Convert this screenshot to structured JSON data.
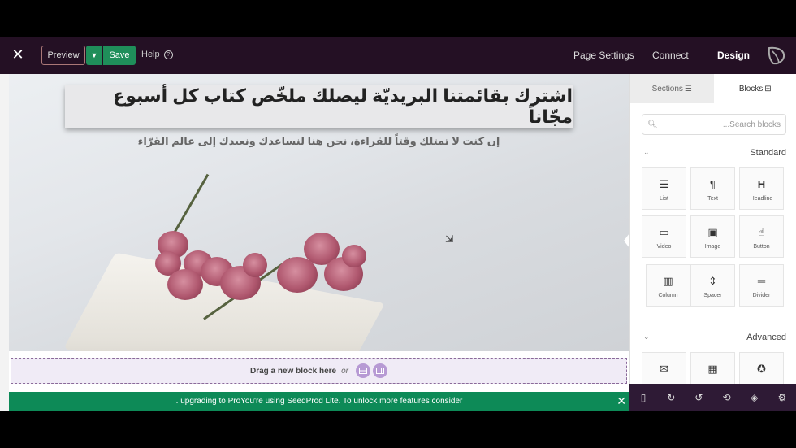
{
  "topbar": {
    "close_icon": "close-icon",
    "preview_label": "Preview",
    "save_label": "Save",
    "help_label": "Help",
    "nav": [
      "Page Settings",
      "Connect",
      "Design"
    ],
    "active_nav": "Design",
    "brand_color": "#241024",
    "save_color": "#1f8e5a"
  },
  "hero": {
    "title": "اشترك بقائمتنا البريديّة ليصلك ملخّص كتاب كل أسبوع مجّاناً",
    "subtitle": "إن كنت لا تمتلك وقتاً للقراءة، نحن هنا لنساعدك ونعيدك إلى عالم القرّاء"
  },
  "dropzone": {
    "label": "Drag a new block here",
    "or": "or"
  },
  "promo": {
    "text": ". upgrading to ProYou're using SeedProd Lite. To unlock more features consider",
    "color": "#0d8a57"
  },
  "sidebar": {
    "tabs": [
      "Sections",
      "Blocks"
    ],
    "active_tab": "Blocks",
    "search_placeholder": "...Search blocks",
    "standard_title": "Standard",
    "standard_blocks": [
      {
        "label": "List",
        "icon": "list-icon"
      },
      {
        "label": "Text",
        "icon": "paragraph-icon"
      },
      {
        "label": "Headline",
        "icon": "heading-icon"
      },
      {
        "label": "Video",
        "icon": "video-icon"
      },
      {
        "label": "Image",
        "icon": "image-icon"
      },
      {
        "label": "Button",
        "icon": "pointer-icon"
      },
      {
        "label": "Column",
        "icon": "columns-icon"
      },
      {
        "label": "Spacer",
        "icon": "spacer-icon"
      },
      {
        "label": "Divider",
        "icon": "divider-icon"
      }
    ],
    "advanced_title": "Advanced"
  },
  "bottom_tools": [
    "mobile-icon",
    "refresh-icon",
    "undo-icon",
    "history-icon",
    "layers-icon",
    "settings-icon"
  ]
}
